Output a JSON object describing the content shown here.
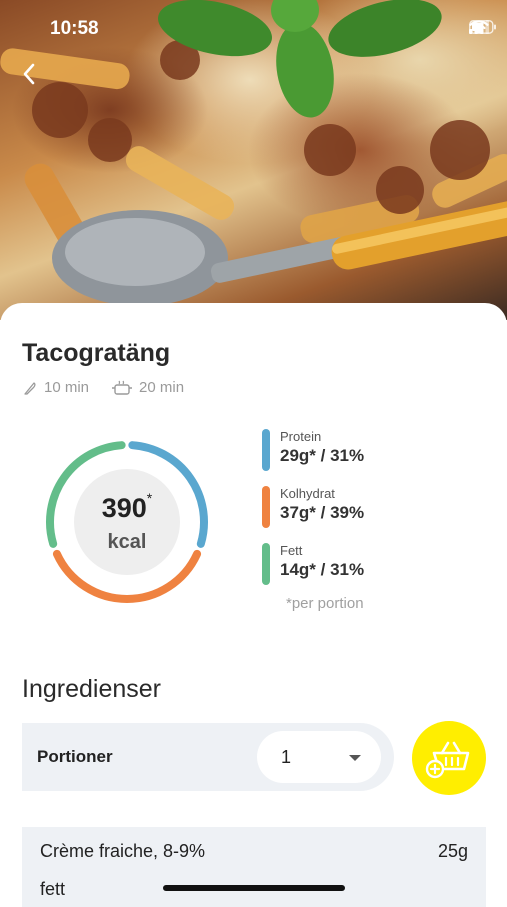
{
  "status_bar": {
    "time": "10:58"
  },
  "recipe": {
    "title": "Tacogratäng",
    "prep_time": "10 min",
    "cook_time": "20 min"
  },
  "nutrition": {
    "kcal_value": "390",
    "kcal_asterisk": "*",
    "kcal_unit": "kcal",
    "macros": [
      {
        "label": "Protein",
        "value": "29g* / 31%",
        "color": "#5aa7cf",
        "percent": 31
      },
      {
        "label": "Kolhydrat",
        "value": "37g* / 39%",
        "color": "#ef8240",
        "percent": 39
      },
      {
        "label": "Fett",
        "value": "14g* / 31%",
        "color": "#63bd8a",
        "percent": 31
      }
    ],
    "footnote": "*per portion"
  },
  "ingredients": {
    "title": "Ingredienser",
    "portions_label": "Portioner",
    "portions_value": "1",
    "basket_color": "#ffee00",
    "items": [
      {
        "name_line1": "Crème fraiche, 8-9%",
        "name_line2": "fett",
        "amount": "25g"
      }
    ]
  }
}
